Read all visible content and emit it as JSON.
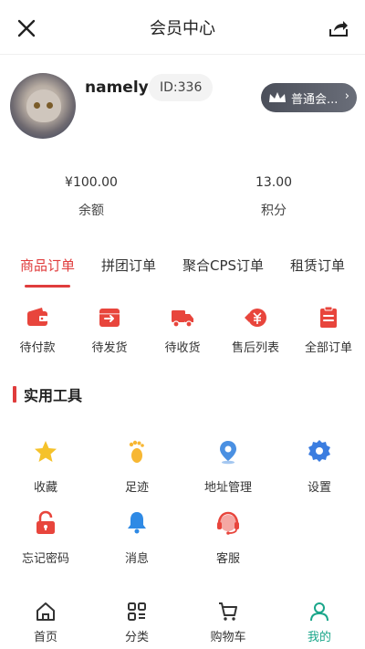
{
  "header": {
    "title": "会员中心"
  },
  "profile": {
    "username": "namely",
    "id_label": "ID:336",
    "member_level": "普通会...",
    "member_chevron": "›"
  },
  "stats": [
    {
      "value": "¥100.00",
      "label": "余额"
    },
    {
      "value": "13.00",
      "label": "积分"
    }
  ],
  "tabs": [
    {
      "label": "商品订单",
      "active": true
    },
    {
      "label": "拼团订单",
      "active": false
    },
    {
      "label": "聚合CPS订单",
      "active": false
    },
    {
      "label": "租赁订单",
      "active": false
    }
  ],
  "orders": [
    {
      "label": "待付款",
      "icon": "wallet-icon"
    },
    {
      "label": "待发货",
      "icon": "outbox-icon"
    },
    {
      "label": "待收货",
      "icon": "truck-icon"
    },
    {
      "label": "售后列表",
      "icon": "refund-icon"
    },
    {
      "label": "全部订单",
      "icon": "clipboard-icon"
    }
  ],
  "tools": {
    "title": "实用工具",
    "items": [
      {
        "label": "收藏",
        "icon": "star-icon",
        "color": "#f5c22b"
      },
      {
        "label": "足迹",
        "icon": "footprint-icon",
        "color": "#f7b733"
      },
      {
        "label": "地址管理",
        "icon": "location-icon",
        "color": "#4a90e2"
      },
      {
        "label": "设置",
        "icon": "gear-icon",
        "color": "#3b7de0"
      },
      {
        "label": "忘记密码",
        "icon": "lock-icon",
        "color": "#e8453c"
      },
      {
        "label": "消息",
        "icon": "bell-icon",
        "color": "#2f8ae5"
      },
      {
        "label": "客服",
        "icon": "headset-icon",
        "color": "#e8453c"
      }
    ]
  },
  "bottom_nav": [
    {
      "label": "首页",
      "icon": "home-icon",
      "active": false
    },
    {
      "label": "分类",
      "icon": "category-icon",
      "active": false
    },
    {
      "label": "购物车",
      "icon": "cart-icon",
      "active": false
    },
    {
      "label": "我的",
      "icon": "user-icon",
      "active": true
    }
  ],
  "colors": {
    "accent": "#e03c3c",
    "nav_active": "#1aa68a"
  }
}
